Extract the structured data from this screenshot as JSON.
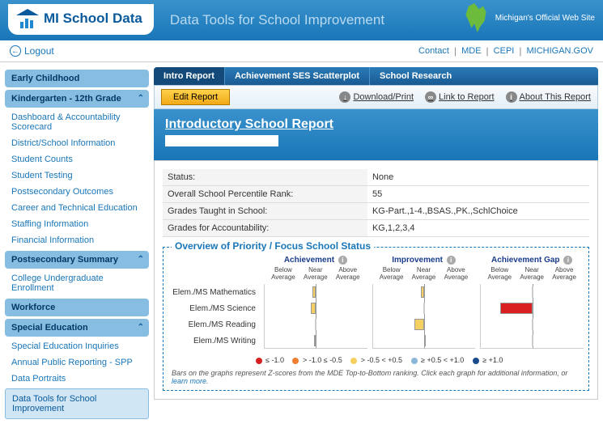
{
  "header": {
    "logo_text": "MI School Data",
    "subtitle": "Data Tools for School Improvement",
    "state_label": "Michigan's Official Web Site"
  },
  "topbar": {
    "logout": "Logout",
    "links": [
      "Contact",
      "MDE",
      "CEPI",
      "MICHIGAN.GOV"
    ]
  },
  "sidebar": {
    "sections": [
      {
        "label": "Early Childhood",
        "items": []
      },
      {
        "label": "Kindergarten - 12th Grade",
        "items": [
          "Dashboard & Accountability Scorecard",
          "District/School Information",
          "Student Counts",
          "Student Testing",
          "Postsecondary Outcomes",
          "Career and Technical Education",
          "Staffing Information",
          "Financial Information"
        ]
      },
      {
        "label": "Postsecondary Summary",
        "items": [
          "College Undergraduate Enrollment"
        ]
      },
      {
        "label": "Workforce",
        "items": []
      },
      {
        "label": "Special Education",
        "items": [
          "Special Education Inquiries",
          "Annual Public Reporting - SPP",
          "Data Portraits"
        ]
      }
    ],
    "active": "Data Tools for School Improvement"
  },
  "tabs": [
    "Intro Report",
    "Achievement SES Scatterplot",
    "School Research"
  ],
  "toolbar": {
    "edit": "Edit Report",
    "download": "Download/Print",
    "link": "Link to Report",
    "about": "About This Report"
  },
  "report": {
    "title": "Introductory School Report",
    "rows": [
      {
        "k": "Status:",
        "v": "None"
      },
      {
        "k": "Overall School Percentile Rank:",
        "v": "55"
      },
      {
        "k": "Grades Taught in School:",
        "v": "KG-Part.,1-4.,BSAS.,PK.,SchlChoice"
      },
      {
        "k": "Grades for Accountability:",
        "v": "KG,1,2,3,4"
      }
    ]
  },
  "overview": {
    "title": "Overview of Priority / Focus School Status",
    "row_labels": [
      "Elem./MS Mathematics",
      "Elem./MS Science",
      "Elem./MS Reading",
      "Elem./MS Writing"
    ],
    "axis": [
      "Below Average",
      "Near Average",
      "Above Average"
    ],
    "charts": [
      "Achievement",
      "Improvement",
      "Achievement Gap"
    ],
    "legend_items": [
      {
        "color": "#d92020",
        "label": "≤ -1.0"
      },
      {
        "color": "#f08030",
        "label": "> -1.0 ≤ -0.5"
      },
      {
        "color": "#f5d060",
        "label": "> -0.5 < +0.5"
      },
      {
        "color": "#8ab8d8",
        "label": "≥ +0.5 < +1.0"
      },
      {
        "color": "#1a4a8a",
        "label": "≥ +1.0"
      }
    ],
    "note": "Bars on the graphs represent Z-scores from the MDE Top-to-Bottom ranking. Click each graph for additional information, or ",
    "note_link": "learn more"
  },
  "chart_data": [
    {
      "type": "bar",
      "title": "Achievement",
      "categories": [
        "Elem./MS Mathematics",
        "Elem./MS Science",
        "Elem./MS Reading",
        "Elem./MS Writing"
      ],
      "values": [
        -0.1,
        -0.15,
        0.0,
        -0.05
      ],
      "xlabel": "",
      "ylabel": "",
      "ylim": [
        -1.5,
        1.5
      ]
    },
    {
      "type": "bar",
      "title": "Improvement",
      "categories": [
        "Elem./MS Mathematics",
        "Elem./MS Science",
        "Elem./MS Reading",
        "Elem./MS Writing"
      ],
      "values": [
        -0.1,
        0.0,
        -0.3,
        0.05
      ],
      "xlabel": "",
      "ylabel": "",
      "ylim": [
        -1.5,
        1.5
      ]
    },
    {
      "type": "bar",
      "title": "Achievement Gap",
      "categories": [
        "Elem./MS Mathematics",
        "Elem./MS Science",
        "Elem./MS Reading",
        "Elem./MS Writing"
      ],
      "values": [
        0.0,
        -1.0,
        0.0,
        0.0
      ],
      "xlabel": "",
      "ylabel": "",
      "ylim": [
        -1.5,
        1.5
      ]
    }
  ]
}
